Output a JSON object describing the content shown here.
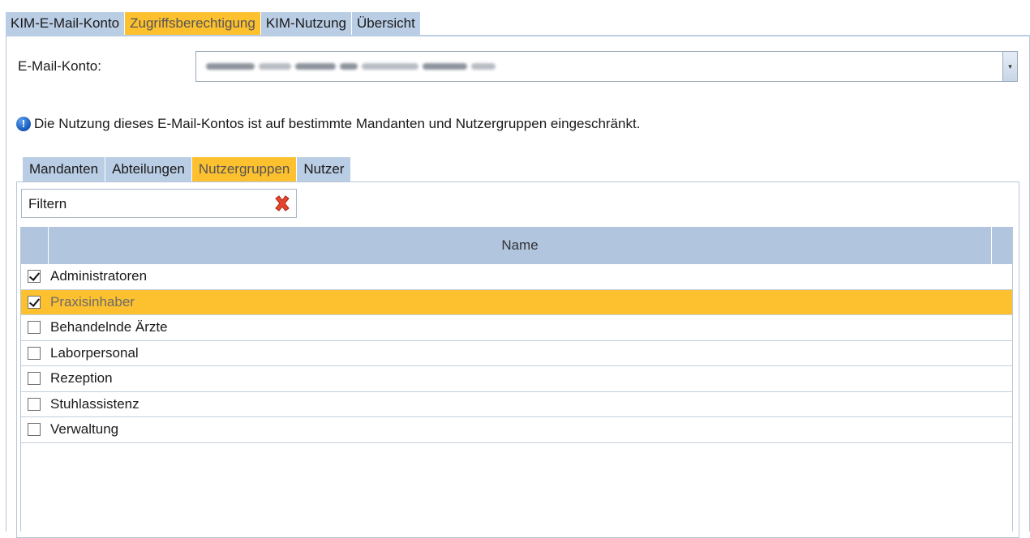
{
  "top_tabs": [
    {
      "label": "KIM-E-Mail-Konto",
      "active": false
    },
    {
      "label": "Zugriffsberechtigung",
      "active": true
    },
    {
      "label": "KIM-Nutzung",
      "active": false
    },
    {
      "label": "Übersicht",
      "active": false
    }
  ],
  "email_account": {
    "label": "E-Mail-Konto:",
    "value_redacted": true
  },
  "info": {
    "icon": "info-icon",
    "message": "Die Nutzung dieses E-Mail-Kontos ist auf bestimmte Mandanten und Nutzergruppen eingeschränkt."
  },
  "inner_tabs": [
    {
      "label": "Mandanten",
      "active": false
    },
    {
      "label": "Abteilungen",
      "active": false
    },
    {
      "label": "Nutzergruppen",
      "active": true
    },
    {
      "label": "Nutzer",
      "active": false
    }
  ],
  "filter": {
    "text": "Filtern",
    "clear_icon": "clear-filter-icon"
  },
  "grid": {
    "column_name": "Name",
    "rows": [
      {
        "name": "Administratoren",
        "checked": true,
        "selected": false
      },
      {
        "name": "Praxisinhaber",
        "checked": true,
        "selected": true
      },
      {
        "name": "Behandelnde Ärzte",
        "checked": false,
        "selected": false
      },
      {
        "name": "Laborpersonal",
        "checked": false,
        "selected": false
      },
      {
        "name": "Rezeption",
        "checked": false,
        "selected": false
      },
      {
        "name": "Stuhlassistenz",
        "checked": false,
        "selected": false
      },
      {
        "name": "Verwaltung",
        "checked": false,
        "selected": false
      }
    ]
  },
  "colors": {
    "tab_inactive": "#b9cde4",
    "tab_active": "#fdc02f",
    "grid_header": "#b1c5de",
    "row_selected": "#fdc02f"
  }
}
